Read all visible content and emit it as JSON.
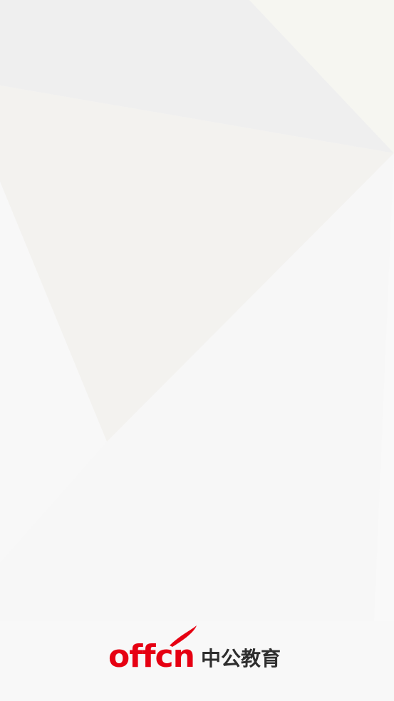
{
  "splash": {
    "brand": {
      "latin": "offcn",
      "chinese": "中公教育",
      "accent_color": "#e60012",
      "text_color": "#2e2e2e"
    },
    "background_color": "#f7f7f7"
  }
}
